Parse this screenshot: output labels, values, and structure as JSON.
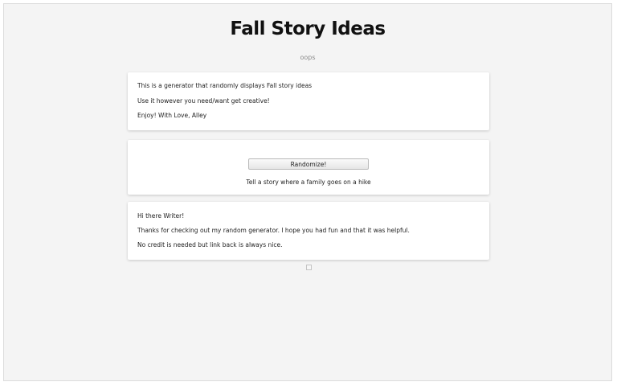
{
  "header": {
    "title": "Fall Story Ideas",
    "subtitle": "oops"
  },
  "intro": {
    "line1": "This is a generator that randomly displays Fall story ideas",
    "line2": "Use it however you need/want get creative!",
    "line3": "Enjoy! With Love, Alley"
  },
  "generator": {
    "button_label": "Randomize!",
    "output": "Tell a story where a family goes on a hike"
  },
  "outro": {
    "line1": "Hi there Writer!",
    "line2": "Thanks for checking out my random generator. I hope you had fun and that it was helpful.",
    "line3": "No credit is needed but link back is always nice."
  },
  "colors": {
    "page_background": "#f4f4f4",
    "card_background": "#ffffff",
    "title_color": "#111111",
    "subtitle_color": "#8a8a8a"
  }
}
